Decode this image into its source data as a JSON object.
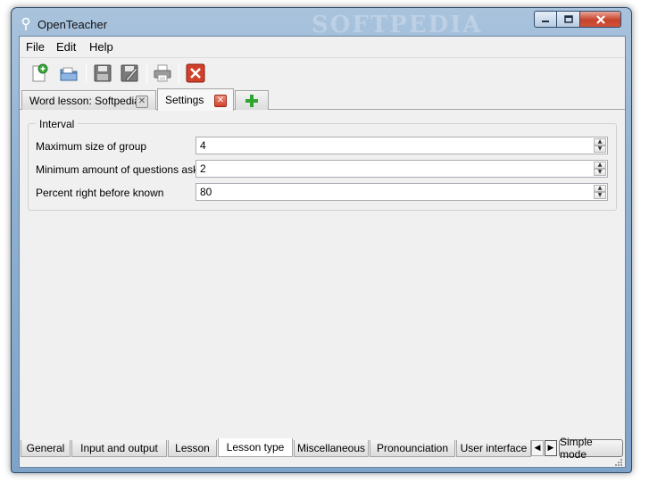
{
  "window": {
    "title": "OpenTeacher",
    "watermark": "SOFTPEDIA"
  },
  "menu": [
    "File",
    "Edit",
    "Help"
  ],
  "toolbar": {
    "icons": [
      "new-icon",
      "open-icon",
      "save-icon",
      "save-as-icon",
      "print-icon",
      "close-icon"
    ]
  },
  "doc_tabs": [
    {
      "label": "Word lesson: Softpedia",
      "active": false
    },
    {
      "label": "Settings",
      "active": true
    }
  ],
  "settings": {
    "group_title": "Interval",
    "rows": [
      {
        "label": "Maximum size of group",
        "value": "4"
      },
      {
        "label": "Minimum amount of questions asked",
        "value": "2"
      },
      {
        "label": "Percent right before known",
        "value": "80"
      }
    ]
  },
  "bottom_tabs": [
    {
      "label": "General",
      "active": false
    },
    {
      "label": "Input and output",
      "active": false
    },
    {
      "label": "Lesson",
      "active": false
    },
    {
      "label": "Lesson type",
      "active": true
    },
    {
      "label": "Miscellaneous",
      "active": false
    },
    {
      "label": "Pronounciation",
      "active": false
    },
    {
      "label": "User interface",
      "active": false
    }
  ],
  "simple_mode_label": "Simple mode",
  "colors": {
    "close_red": "#d2432c",
    "add_green": "#2fa52f"
  }
}
